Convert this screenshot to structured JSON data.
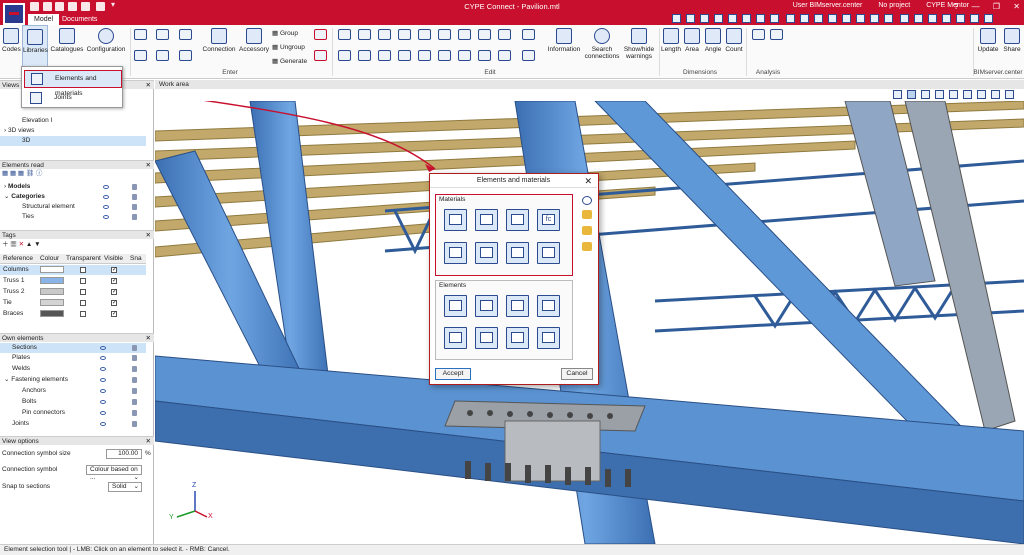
{
  "titlebar": {
    "title": "CYPE Connect - Pavilion.mtl",
    "user": "User BIMserver.center",
    "project": "No project",
    "mentor": "CYPE Mentor"
  },
  "tabs": [
    "Model",
    "Documents"
  ],
  "ribbon": {
    "codes": "Codes",
    "libraries": "Libraries",
    "catalogues": "Catalogues",
    "configuration": "Configuration",
    "connection": "Connection",
    "accessory": "Accessory",
    "group": "Group",
    "ungroup": "Ungroup",
    "generate": "Generate",
    "information": "Information",
    "search_connections": "Search connections",
    "show_hide_warnings": "Show/hide warnings",
    "length": "Length",
    "area": "Area",
    "angle": "Angle",
    "count": "Count",
    "update": "Update",
    "share": "Share",
    "groups": {
      "enter": "Enter",
      "edit": "Edit",
      "dimensions": "Dimensions",
      "analysis": "Analysis",
      "bimserver": "BIMserver.center"
    }
  },
  "dropdown": {
    "item1": "Elements and materials",
    "item2": "Joints"
  },
  "panels": {
    "views": {
      "title": "Views",
      "rows": [
        "Elevation I",
        "3D views",
        "3D"
      ]
    },
    "elements_read": {
      "title": "Elements read",
      "rows": [
        "Models",
        "Categories",
        "Structural element",
        "Ties"
      ]
    },
    "tags": {
      "title": "Tags",
      "columns": [
        "Reference",
        "Colour",
        "Transparent",
        "Visible",
        "Sna"
      ],
      "rows": [
        {
          "ref": "Columns",
          "color": "#ffffff",
          "transparent": false,
          "visible": true
        },
        {
          "ref": "Truss 1",
          "color": "#8ab4e8",
          "transparent": false,
          "visible": true
        },
        {
          "ref": "Truss 2",
          "color": "#c9c9c9",
          "transparent": false,
          "visible": true
        },
        {
          "ref": "Tie",
          "color": "#d4d4d4",
          "transparent": false,
          "visible": true
        },
        {
          "ref": "Braces",
          "color": "#555555",
          "transparent": false,
          "visible": true
        }
      ]
    },
    "own_elements": {
      "title": "Own elements",
      "rows": [
        "Sections",
        "Plates",
        "Welds",
        "Fastening elements",
        "Anchors",
        "Bolts",
        "Pin connectors",
        "Joints"
      ]
    },
    "view_options": {
      "title": "View options",
      "symbol_size_label": "Connection symbol size",
      "symbol_size_value": "100.00",
      "symbol_size_unit": "%",
      "symbol_label": "Connection symbol",
      "symbol_value": "Colour based on ...",
      "snap_label": "Snap to sections",
      "snap_value": "Solid"
    }
  },
  "workarea": {
    "title": "Work area"
  },
  "dialog": {
    "title": "Elements and materials",
    "materials_label": "Materials",
    "elements_label": "Elements",
    "accept": "Accept",
    "cancel": "Cancel"
  },
  "axes": {
    "x": "X",
    "y": "Y",
    "z": "Z"
  },
  "status": "Element selection tool | - LMB: Click on an element to select it. - RMB: Cancel.",
  "colors": {
    "brand": "#c8102e",
    "steel_blue": "#5b9bd5",
    "timber": "#b8a26a",
    "selection": "#cde3f7"
  }
}
